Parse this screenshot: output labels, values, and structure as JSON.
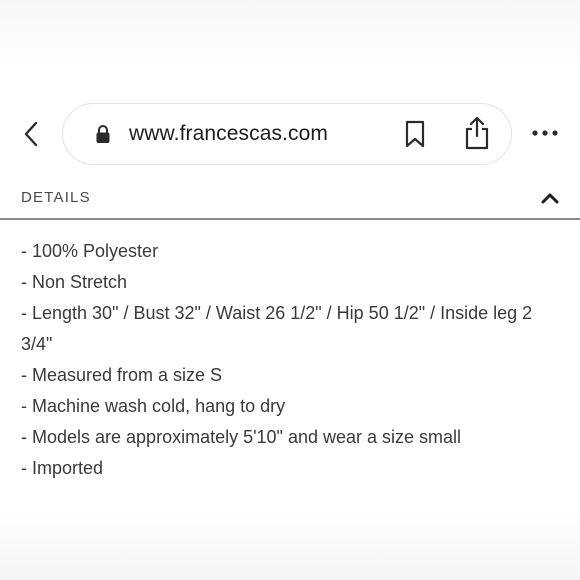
{
  "browser": {
    "url": "www.francescas.com",
    "icons": {
      "back": "chevron-left-icon",
      "lock": "lock-icon",
      "bookmark": "bookmark-icon",
      "share": "share-icon",
      "more": "more-horizontal-icon"
    }
  },
  "details": {
    "title": "DETAILS",
    "toggle_icon": "chevron-up-icon",
    "items": [
      "- 100% Polyester",
      "- Non Stretch",
      "- Length 30\" / Bust 32\" / Waist 26 1/2\" / Hip 50 1/2\" / Inside leg 2 3/4\"",
      "- Measured from a size S",
      "- Machine wash cold, hang to dry",
      "- Models are approximately 5'10\" and wear a size small",
      "- Imported"
    ]
  },
  "colors": {
    "text": "#3a3a3a",
    "url_text": "#1d1d1d",
    "icon": "#2b2b2b",
    "divider": "#8a8a8a",
    "pill_border": "#e2e2e2"
  }
}
